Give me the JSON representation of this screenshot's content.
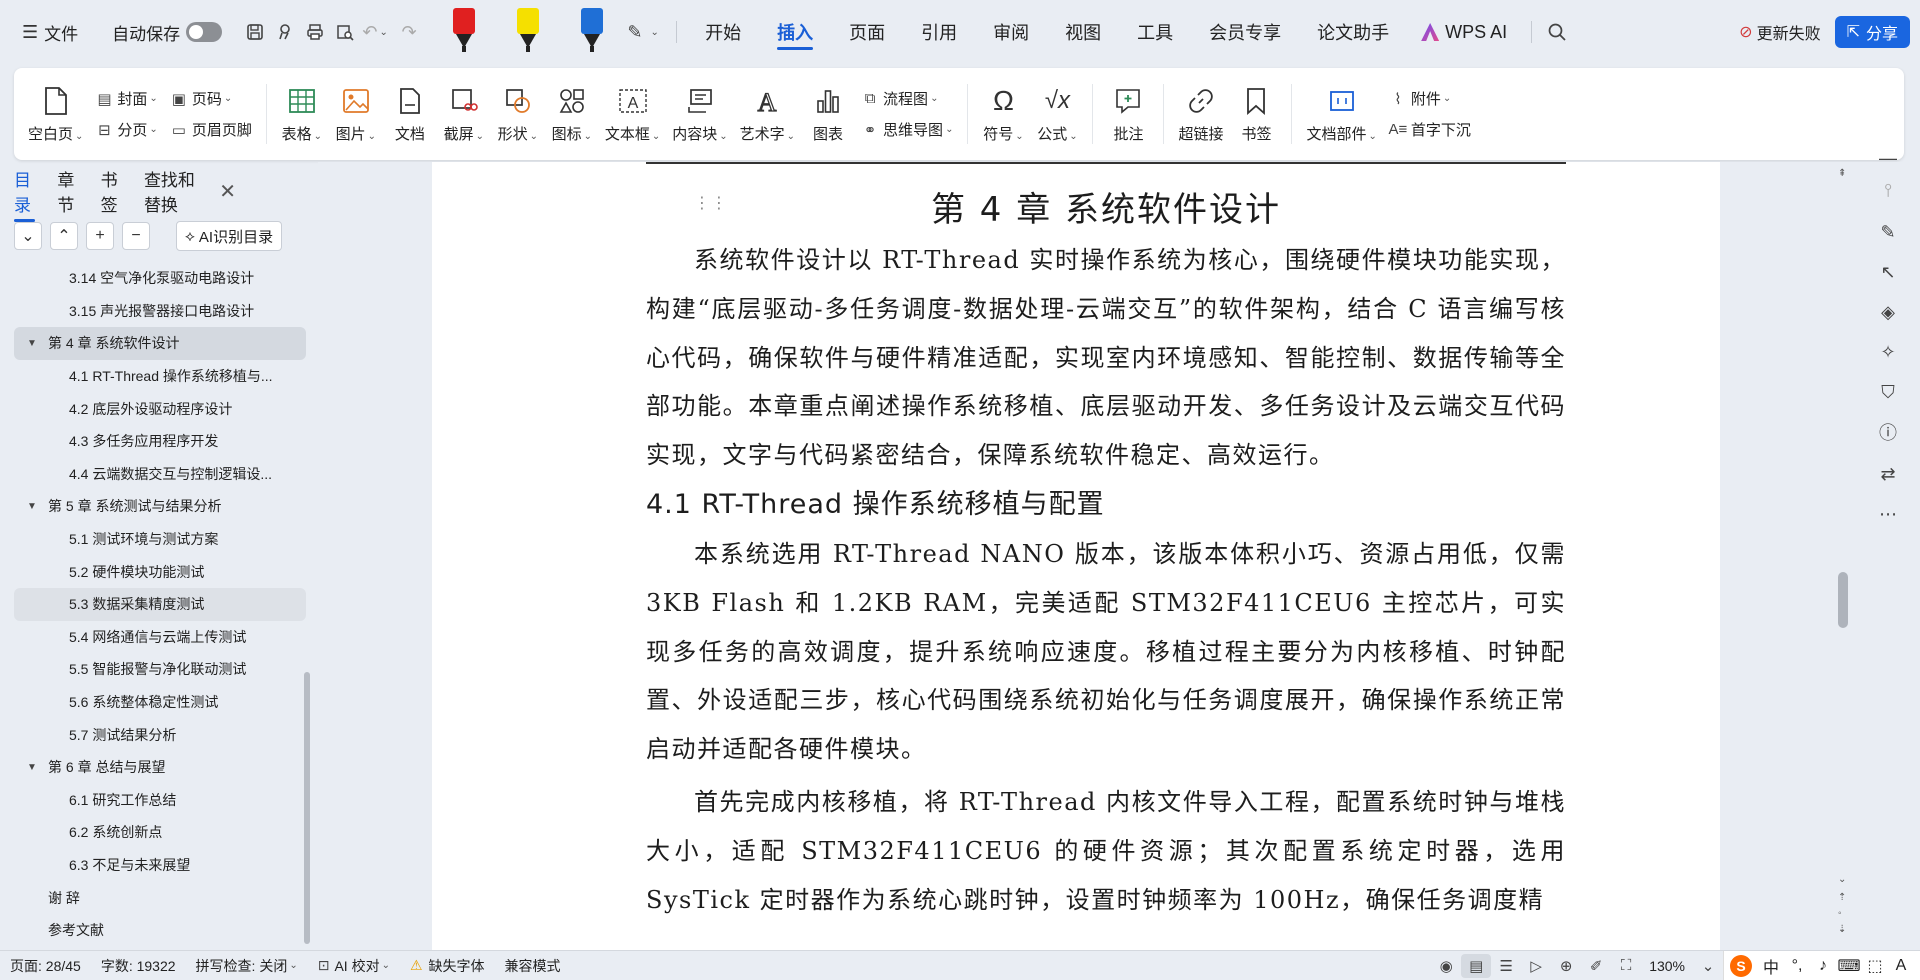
{
  "topbar": {
    "file_label": "文件",
    "autosave_label": "自动保存",
    "menus": [
      "开始",
      "插入",
      "页面",
      "引用",
      "审阅",
      "视图",
      "工具",
      "会员专享",
      "论文助手"
    ],
    "active_menu": "插入",
    "wps_ai_label": "WPS AI",
    "update_fail_label": "更新失败",
    "share_label": "分享",
    "pens": [
      {
        "name": "red-marker",
        "color": "#e02020"
      },
      {
        "name": "yellow-highlighter",
        "color": "#f5e000"
      },
      {
        "name": "blue-marker",
        "color": "#1f6fd6"
      }
    ]
  },
  "ribbon": {
    "blank_page": "空白页",
    "cover": "封面",
    "section_break": "分页",
    "page_number": "页码",
    "header_footer": "页眉页脚",
    "table": "表格",
    "picture": "图片",
    "document": "文档",
    "screenshot": "截屏",
    "shape": "形状",
    "icon": "图标",
    "textbox": "文本框",
    "content_block": "内容块",
    "wordart": "艺术字",
    "chart": "图表",
    "flowchart": "流程图",
    "mindmap": "思维导图",
    "symbol": "符号",
    "formula": "公式",
    "comment": "批注",
    "hyperlink": "超链接",
    "bookmark": "书签",
    "doc_parts": "文档部件",
    "attachment": "附件",
    "drop_cap": "首字下沉"
  },
  "nav": {
    "tabs": [
      "目录",
      "章节",
      "书签",
      "查找和替换"
    ],
    "active_tab": "目录",
    "ai_toc_label": "AI识别目录",
    "toc": [
      {
        "level": 2,
        "label": "3.14  空气净化泵驱动电路设计"
      },
      {
        "level": 2,
        "label": "3.15  声光报警器接口电路设计"
      },
      {
        "level": 1,
        "label": "第 4 章  系统软件设计",
        "expanded": true,
        "selected": true
      },
      {
        "level": 2,
        "label": "4.1 RT-Thread 操作系统移植与..."
      },
      {
        "level": 2,
        "label": "4.2  底层外设驱动程序设计"
      },
      {
        "level": 2,
        "label": "4.3  多任务应用程序开发"
      },
      {
        "level": 2,
        "label": "4.4  云端数据交互与控制逻辑设..."
      },
      {
        "level": 1,
        "label": "第 5 章  系统测试与结果分析",
        "expanded": true
      },
      {
        "level": 2,
        "label": "5.1  测试环境与测试方案"
      },
      {
        "level": 2,
        "label": "5.2  硬件模块功能测试"
      },
      {
        "level": 2,
        "label": "5.3  数据采集精度测试",
        "hover": true
      },
      {
        "level": 2,
        "label": "5.4  网络通信与云端上传测试"
      },
      {
        "level": 2,
        "label": "5.5  智能报警与净化联动测试"
      },
      {
        "level": 2,
        "label": "5.6  系统整体稳定性测试"
      },
      {
        "level": 2,
        "label": "5.7  测试结果分析"
      },
      {
        "level": 1,
        "label": "第 6 章  总结与展望",
        "expanded": true
      },
      {
        "level": 2,
        "label": "6.1  研究工作总结"
      },
      {
        "level": 2,
        "label": "6.2  系统创新点"
      },
      {
        "level": 2,
        "label": "6.3  不足与未来展望"
      },
      {
        "level": 1,
        "label": "谢    辞",
        "noarrow": true
      },
      {
        "level": 1,
        "label": "参考文献",
        "noarrow_flush": true
      }
    ]
  },
  "document": {
    "chapter_title": "第 4 章  系统软件设计",
    "para1": "系统软件设计以 RT-Thread 实时操作系统为核心，围绕硬件模块功能实现，构建“底层驱动-多任务调度-数据处理-云端交互”的软件架构，结合 C 语言编写核心代码，确保软件与硬件精准适配，实现室内环境感知、智能控制、数据传输等全部功能。本章重点阐述操作系统移植、底层驱动开发、多任务设计及云端交互代码实现，文字与代码紧密结合，保障系统软件稳定、高效运行。",
    "section_title": "4.1 RT-Thread 操作系统移植与配置",
    "para2": "本系统选用 RT-Thread NANO 版本，该版本体积小巧、资源占用低，仅需 3KB Flash 和 1.2KB RAM，完美适配 STM32F411CEU6 主控芯片，可实现多任务的高效调度，提升系统响应速度。移植过程主要分为内核移植、时钟配置、外设适配三步，核心代码围绕系统初始化与任务调度展开，确保操作系统正常启动并适配各硬件模块。",
    "para3": "首先完成内核移植，将 RT-Thread 内核文件导入工程，配置系统时钟与堆栈大小，适配 STM32F411CEU6 的硬件资源；其次配置系统定时器，选用 SysTick 定时器作为系统心跳时钟，设置时钟频率为 100Hz，确保任务调度精"
  },
  "statusbar": {
    "page": "页面: 28/45",
    "word_count": "字数: 19322",
    "spell_check": "拼写检查: 关闭",
    "ai_proof": "AI 校对",
    "missing_font": "缺失字体",
    "compat_mode": "兼容模式",
    "zoom": "130%",
    "ime_chinese": "中"
  },
  "colors": {
    "accent": "#1a5fd6",
    "share_bg": "#1a66e0",
    "warn": "#e8a000",
    "update_fail": "#d23b3b"
  }
}
